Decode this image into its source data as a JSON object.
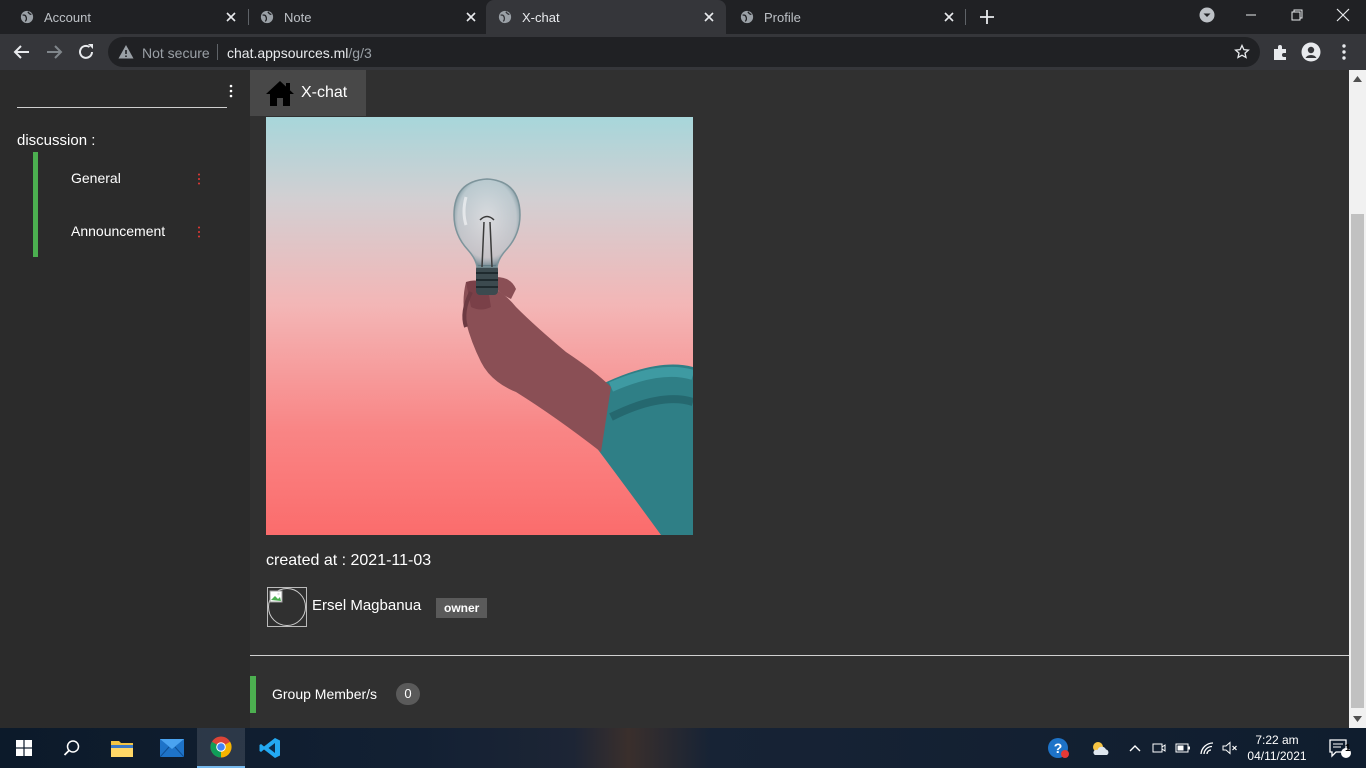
{
  "browser": {
    "tabs": [
      {
        "label": "Account",
        "active": false
      },
      {
        "label": "Note",
        "active": false
      },
      {
        "label": "X-chat",
        "active": true
      },
      {
        "label": "Profile",
        "active": false
      }
    ],
    "address": {
      "security_label": "Not secure",
      "host": "chat.appsources.ml",
      "path": "/g/3"
    }
  },
  "sidebar": {
    "section_title": "discussion :",
    "channels": [
      {
        "label": "General"
      },
      {
        "label": "Announcement"
      }
    ]
  },
  "main": {
    "brand_label": "X-chat",
    "created_at": "created at : 2021-11-03",
    "owner": {
      "name": "Ersel Magbanua",
      "badge": "owner"
    },
    "members": {
      "label": "Group Member/s",
      "count": "0"
    }
  },
  "taskbar": {
    "time": "7:22 am",
    "date": "04/11/2021",
    "notification_count": "1"
  },
  "colors": {
    "accent_green": "#4caf50",
    "page_bg": "#303030",
    "sidebar_bg": "#2b2b2b",
    "kebab_red": "#e53935"
  }
}
